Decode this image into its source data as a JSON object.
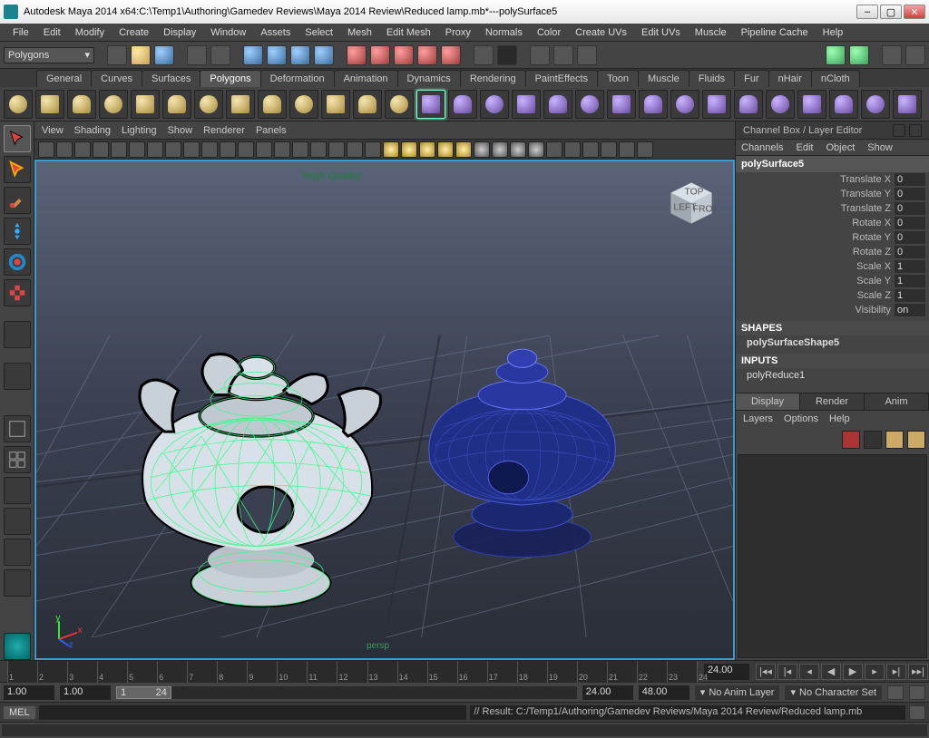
{
  "title": {
    "app": "Autodesk Maya 2014 x64: ",
    "file": "C:\\Temp1\\Authoring\\Gamedev Reviews\\Maya 2014 Review\\Reduced lamp.mb*",
    "sep": "   ---   ",
    "object": "polySurface5"
  },
  "menubar": [
    "File",
    "Edit",
    "Modify",
    "Create",
    "Display",
    "Window",
    "Assets",
    "Select",
    "Mesh",
    "Edit Mesh",
    "Proxy",
    "Normals",
    "Color",
    "Create UVs",
    "Edit UVs",
    "Muscle",
    "Pipeline Cache",
    "Help"
  ],
  "mode_dropdown": "Polygons",
  "shelf_tabs": [
    "General",
    "Curves",
    "Surfaces",
    "Polygons",
    "Deformation",
    "Animation",
    "Dynamics",
    "Rendering",
    "PaintEffects",
    "Toon",
    "Muscle",
    "Fluids",
    "Fur",
    "nHair",
    "nCloth"
  ],
  "shelf_active": "Polygons",
  "vp_menus": [
    "View",
    "Shading",
    "Lighting",
    "Show",
    "Renderer",
    "Panels"
  ],
  "vp_hq": "High Quality",
  "vp_cam": "persp",
  "viewcube_faces": {
    "top": "TOP",
    "left": "LEFT",
    "front": "FRONT"
  },
  "rightpanel": {
    "title": "Channel Box / Layer Editor",
    "menus": [
      "Channels",
      "Edit",
      "Object",
      "Show"
    ],
    "object": "polySurface5",
    "attrs": [
      {
        "lbl": "Translate X",
        "val": "0"
      },
      {
        "lbl": "Translate Y",
        "val": "0"
      },
      {
        "lbl": "Translate Z",
        "val": "0"
      },
      {
        "lbl": "Rotate X",
        "val": "0"
      },
      {
        "lbl": "Rotate Y",
        "val": "0"
      },
      {
        "lbl": "Rotate Z",
        "val": "0"
      },
      {
        "lbl": "Scale X",
        "val": "1"
      },
      {
        "lbl": "Scale Y",
        "val": "1"
      },
      {
        "lbl": "Scale Z",
        "val": "1"
      },
      {
        "lbl": "Visibility",
        "val": "on"
      }
    ],
    "shapes_hdr": "SHAPES",
    "shape_item": "polySurfaceShape5",
    "inputs_hdr": "INPUTS",
    "input_item": "polyReduce1",
    "layer_tabs": [
      "Display",
      "Render",
      "Anim"
    ],
    "layer_tab_active": "Display",
    "layer_menus": [
      "Layers",
      "Options",
      "Help"
    ]
  },
  "timeline": {
    "ticks": [
      1,
      2,
      3,
      4,
      5,
      6,
      7,
      8,
      9,
      10,
      11,
      12,
      13,
      14,
      15,
      16,
      17,
      18,
      19,
      20,
      21,
      22,
      23,
      24
    ],
    "current": "24.00"
  },
  "range": {
    "start_outer": "1.00",
    "start_inner": "1.00",
    "in": "1",
    "out": "24",
    "end_inner": "24.00",
    "end_outer": "48.00",
    "anim_layer": "No Anim Layer",
    "char_set": "No Character Set"
  },
  "cmd": {
    "lang": "MEL",
    "result": "// Result: C:/Temp1/Authoring/Gamedev Reviews/Maya 2014 Review/Reduced lamp.mb"
  }
}
